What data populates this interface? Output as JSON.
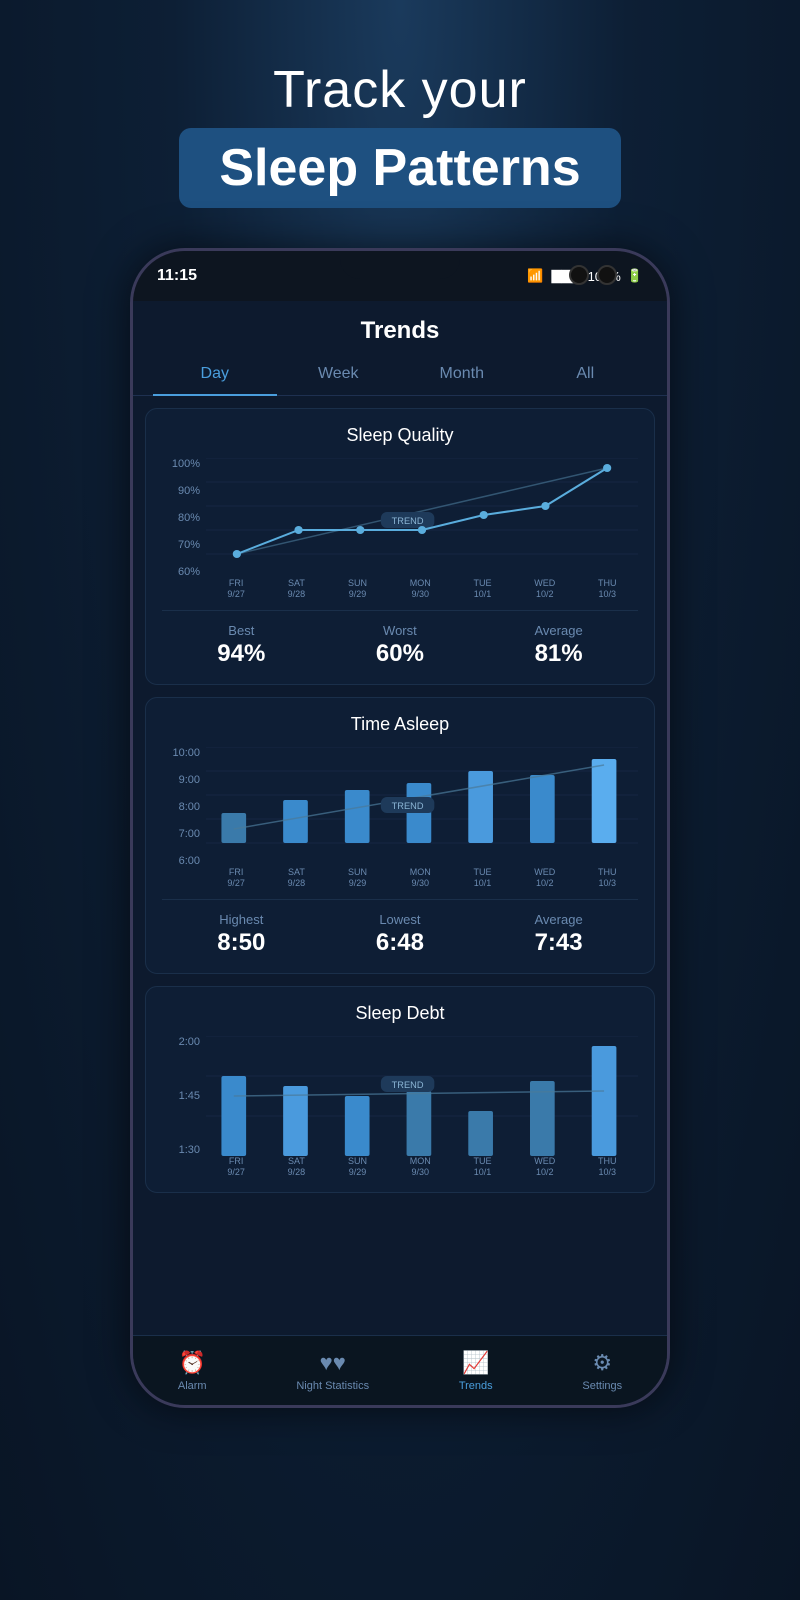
{
  "hero": {
    "line1": "Track your",
    "line2": "Sleep Patterns"
  },
  "phone": {
    "time": "11:15",
    "battery": "100%",
    "signal": "●●●●",
    "wifi": "WiFi"
  },
  "app": {
    "title": "Trends",
    "tabs": [
      "Day",
      "Week",
      "Month",
      "All"
    ],
    "active_tab": "Day"
  },
  "sleep_quality": {
    "title": "Sleep Quality",
    "y_labels": [
      "100%",
      "90%",
      "80%",
      "70%",
      "60%"
    ],
    "x_labels": [
      {
        "day": "FRI",
        "date": "9/27"
      },
      {
        "day": "SAT",
        "date": "9/28"
      },
      {
        "day": "SUN",
        "date": "9/29"
      },
      {
        "day": "MON",
        "date": "9/30"
      },
      {
        "day": "TUE",
        "date": "10/1"
      },
      {
        "day": "WED",
        "date": "10/2"
      },
      {
        "day": "THU",
        "date": "10/3"
      }
    ],
    "trend_label": "TREND",
    "stats": {
      "best_label": "Best",
      "best_value": "94%",
      "worst_label": "Worst",
      "worst_value": "60%",
      "average_label": "Average",
      "average_value": "81%"
    }
  },
  "time_asleep": {
    "title": "Time Asleep",
    "y_labels": [
      "10:00",
      "9:00",
      "8:00",
      "7:00",
      "6:00"
    ],
    "x_labels": [
      {
        "day": "FRI",
        "date": "9/27"
      },
      {
        "day": "SAT",
        "date": "9/28"
      },
      {
        "day": "SUN",
        "date": "9/29"
      },
      {
        "day": "MON",
        "date": "9/30"
      },
      {
        "day": "TUE",
        "date": "10/1"
      },
      {
        "day": "WED",
        "date": "10/2"
      },
      {
        "day": "THU",
        "date": "10/3"
      }
    ],
    "trend_label": "TREND",
    "stats": {
      "highest_label": "Highest",
      "highest_value": "8:50",
      "lowest_label": "Lowest",
      "lowest_value": "6:48",
      "average_label": "Average",
      "average_value": "7:43"
    }
  },
  "sleep_debt": {
    "title": "Sleep Debt",
    "y_labels": [
      "2:00",
      "1:45",
      "1:30"
    ],
    "trend_label": "TREND"
  },
  "nav": {
    "items": [
      {
        "icon": "alarm",
        "label": "Alarm",
        "active": false
      },
      {
        "icon": "bar-chart",
        "label": "Night Statistics",
        "active": false
      },
      {
        "icon": "trend",
        "label": "Trends",
        "active": true
      },
      {
        "icon": "settings",
        "label": "Settings",
        "active": false
      }
    ]
  }
}
